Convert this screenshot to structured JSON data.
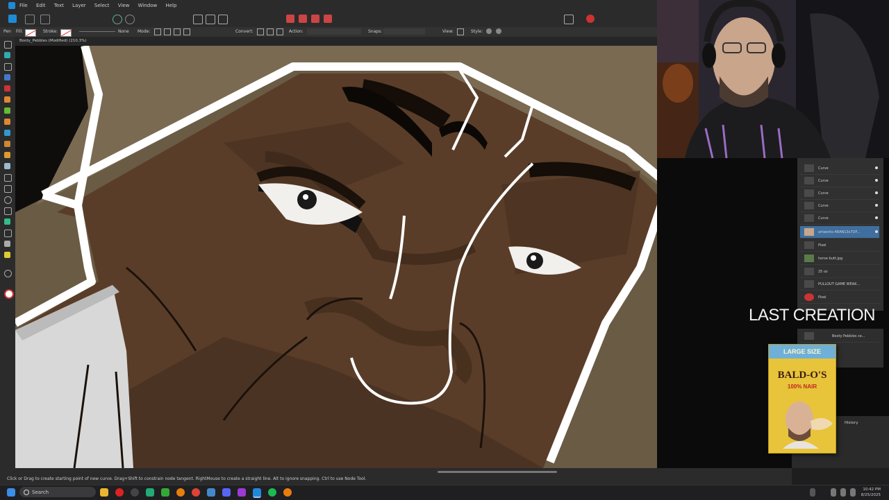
{
  "menu": [
    "File",
    "Edit",
    "Layer",
    "Text",
    "Select",
    "View",
    "Window",
    "Help"
  ],
  "context_bar": {
    "tool_label": "Pen",
    "fill_label": "Fill:",
    "stroke_label": "Stroke:",
    "stroke_value": "None",
    "mode_label": "Mode:",
    "convert_label": "Convert:",
    "action_label": "Action:",
    "snaps_label": "Snaps:",
    "view_label": "View:",
    "style_label": "Style:"
  },
  "document_tab": "Booty_Pebbles (Modified) (210.3%)",
  "status_hint": "Click or Drag to create starting point of new curve. Drag+Shift to constrain node tangent. RightMouse to create a straight line. Alt to ignore snapping. Ctrl to use Node Tool.",
  "layers": [
    {
      "name": "Curve"
    },
    {
      "name": "Curve"
    },
    {
      "name": "Curve"
    },
    {
      "name": "Curve"
    },
    {
      "name": "Curve"
    },
    {
      "name": "artworks-4BAN13s7OF..."
    },
    {
      "name": "Pixel"
    },
    {
      "name": "horse butt.jpg"
    },
    {
      "name": "25 oz"
    },
    {
      "name": "PULLOUT GAME WEAK..."
    },
    {
      "name": "Pixel"
    },
    {
      "name": "Booty Pebbles ce..."
    }
  ],
  "overlay": {
    "last_creation": "LAST CREATION",
    "cereal_top": "LARGE SIZE",
    "cereal_brand": "BALD-O'S",
    "cereal_sub": "100% NAIR"
  },
  "history_tab": "History",
  "taskbar": {
    "search_placeholder": "Search",
    "time": "10:42 PM",
    "date": "8/25/2025"
  },
  "colors": {
    "accent": "#4aa3df",
    "canvas_skin": "#5a3d28",
    "hat": "#6b5a44"
  }
}
